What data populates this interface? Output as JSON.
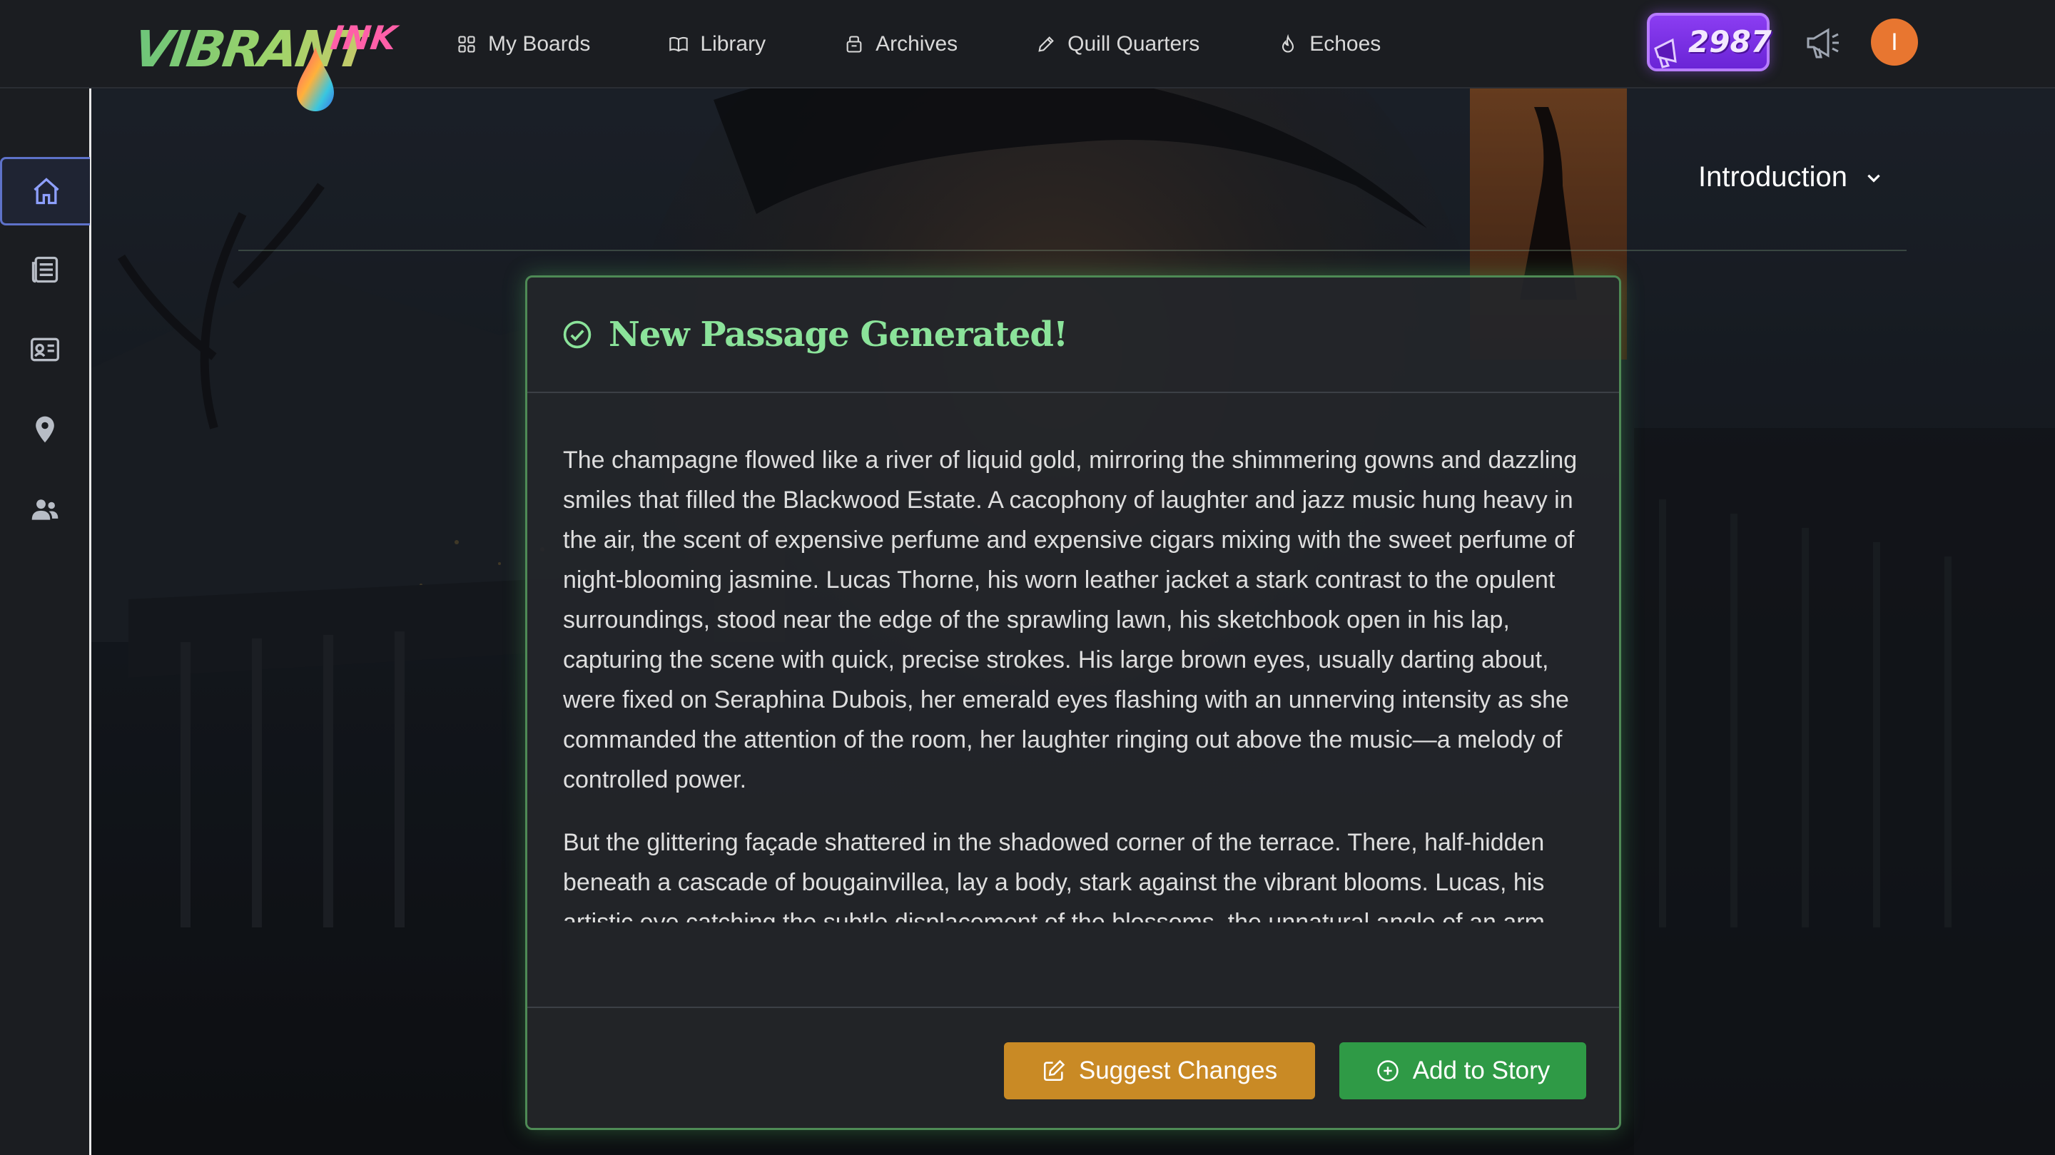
{
  "brand": {
    "logo_word": "VIBRANT",
    "logo_ink": "INK"
  },
  "nav": [
    {
      "label": "My Boards",
      "icon": "grid-icon"
    },
    {
      "label": "Library",
      "icon": "book-icon"
    },
    {
      "label": "Archives",
      "icon": "archive-icon"
    },
    {
      "label": "Quill Quarters",
      "icon": "pencil-icon"
    },
    {
      "label": "Echoes",
      "icon": "flame-icon"
    }
  ],
  "header": {
    "points": "2987",
    "avatar_initial": "I"
  },
  "sidebar": [
    {
      "icon": "home-icon",
      "active": true
    },
    {
      "icon": "newspaper-icon",
      "active": false
    },
    {
      "icon": "id-card-icon",
      "active": false
    },
    {
      "icon": "map-pin-icon",
      "active": false
    },
    {
      "icon": "people-icon",
      "active": false
    }
  ],
  "section": {
    "title": "Introduction"
  },
  "passage": {
    "title": "New Passage Generated!",
    "paragraphs": [
      "The champagne flowed like a river of liquid gold, mirroring the shimmering gowns and dazzling smiles that filled the Blackwood Estate. A cacophony of laughter and jazz music hung heavy in the air, the scent of expensive perfume and expensive cigars mixing with the sweet perfume of night-blooming jasmine. Lucas Thorne, his worn leather jacket a stark contrast to the opulent surroundings, stood near the edge of the sprawling lawn, his sketchbook open in his lap, capturing the scene with quick, precise strokes. His large brown eyes, usually darting about, were fixed on Seraphina Dubois, her emerald eyes flashing with an unnerving intensity as she commanded the attention of the room, her laughter ringing out above the music—a melody of controlled power.",
      "But the glittering façade shattered in the shadowed corner of the terrace. There, half-hidden beneath a cascade of bougainvillea, lay a body, stark against the vibrant blooms. Lucas, his artistic eye catching the subtle displacement of the blossoms, the unnatural angle of an arm, was the first to notice. The initial shock gave way to an unsettling"
    ],
    "suggest_label": "Suggest Changes",
    "add_label": "Add to Story"
  },
  "colors": {
    "accent_green": "#8be39a",
    "suggest_button": "#c98a25",
    "add_button": "#2f9a46",
    "points_badge": "#7a30e6",
    "avatar": "#e87630"
  }
}
